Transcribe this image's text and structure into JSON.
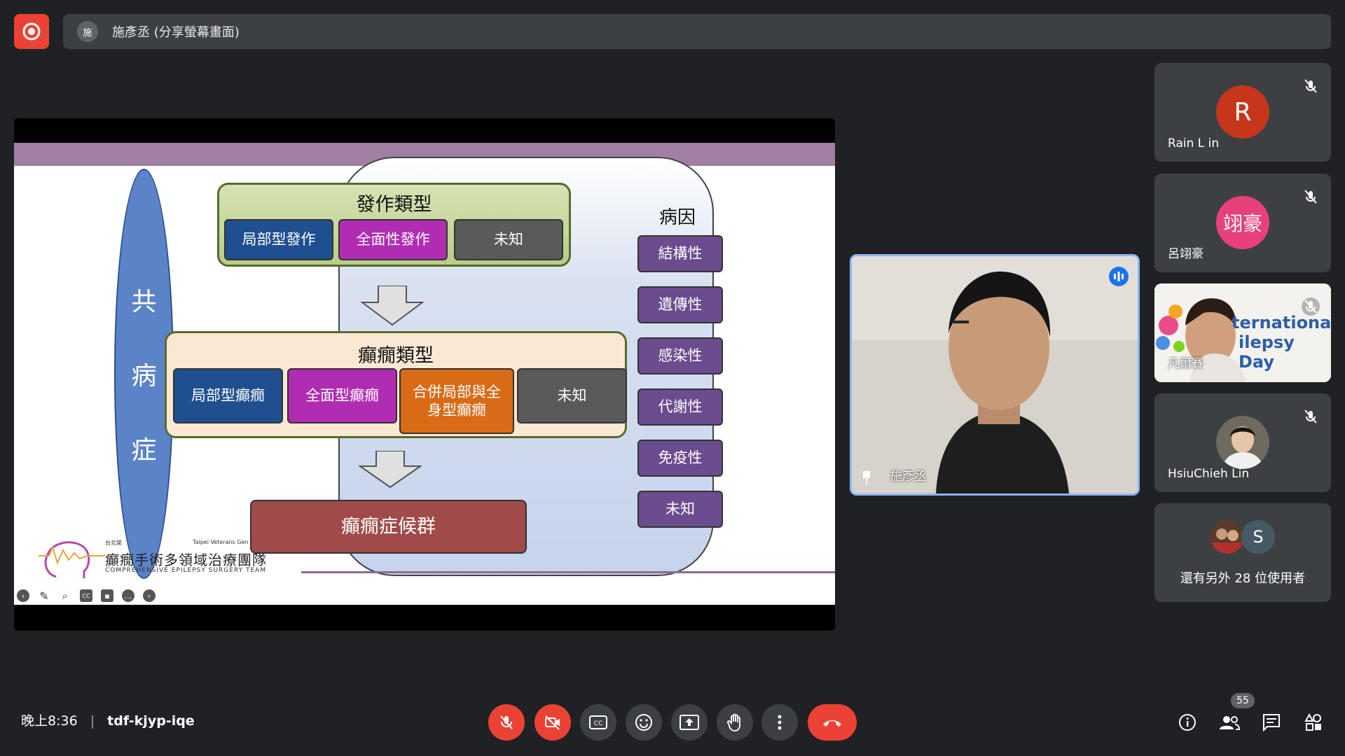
{
  "top": {
    "presenter_initial": "施",
    "presenter_label": "施彥丞 (分享螢幕畫面)"
  },
  "slide": {
    "comorbidity_chars": [
      "共",
      "病",
      "症"
    ],
    "seizure_types": {
      "title": "發作類型",
      "items": [
        "局部型發作",
        "全面性發作",
        "未知"
      ]
    },
    "epilepsy_types": {
      "title": "癲癇類型",
      "items": [
        "局部型癲癇",
        "全面型癲癇",
        "合併局部與全身型癲癇",
        "未知"
      ]
    },
    "syndrome": "癲癇症候群",
    "etiology": {
      "title": "病因",
      "items": [
        "結構性",
        "遺傳性",
        "感染性",
        "代謝性",
        "免疫性",
        "未知"
      ]
    },
    "logo_small": "台北榮",
    "logo_en_top": "Taipei Veterans Gen",
    "logo_main": "癲癇手術多領域治療團隊",
    "logo_en": "COMPREHENSIVE EPILEPSY SURGERY TEAM"
  },
  "speaker": {
    "name": "施彥丞"
  },
  "participants": [
    {
      "name": "Rain L in",
      "initial": "R",
      "color": "#c5361b"
    },
    {
      "name": "呂翊豪",
      "initial": "翊豪",
      "color": "#e8407a"
    },
    {
      "name": "凡爾賽",
      "banner_1": "ternational",
      "banner_2": "ilepsy Day"
    },
    {
      "name": "HsiuChieh Lin"
    },
    {
      "others_label": "還有另外 28 位使用者",
      "initial": "S"
    }
  ],
  "bottom": {
    "time": "晚上8:36",
    "meeting_code": "tdf-kjyp-iqe",
    "participant_count": "55"
  },
  "colors": {
    "accent": "#8ab4f8",
    "red": "#ea4335"
  }
}
